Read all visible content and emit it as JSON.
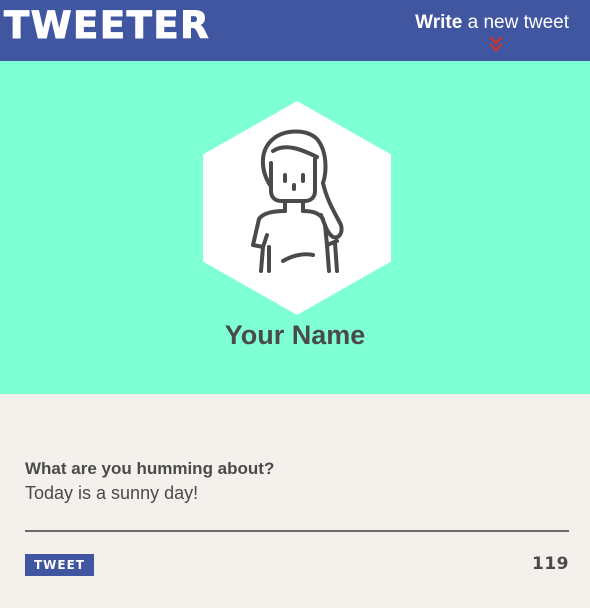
{
  "header": {
    "logo": "TWEETER",
    "compose_strong": "Write",
    "compose_rest": " a new tweet",
    "chevron_icon": "double-chevron-down-icon",
    "background": "#4056a1",
    "chevron_color": "#c0392b"
  },
  "profile": {
    "name": "Your Name",
    "avatar_icon": "woman-avatar-icon",
    "background": "#7fffd4"
  },
  "composer": {
    "label": "What are you humming about?",
    "value": "Today is a sunny day!",
    "button_label": "TWEET",
    "counter": "119"
  }
}
